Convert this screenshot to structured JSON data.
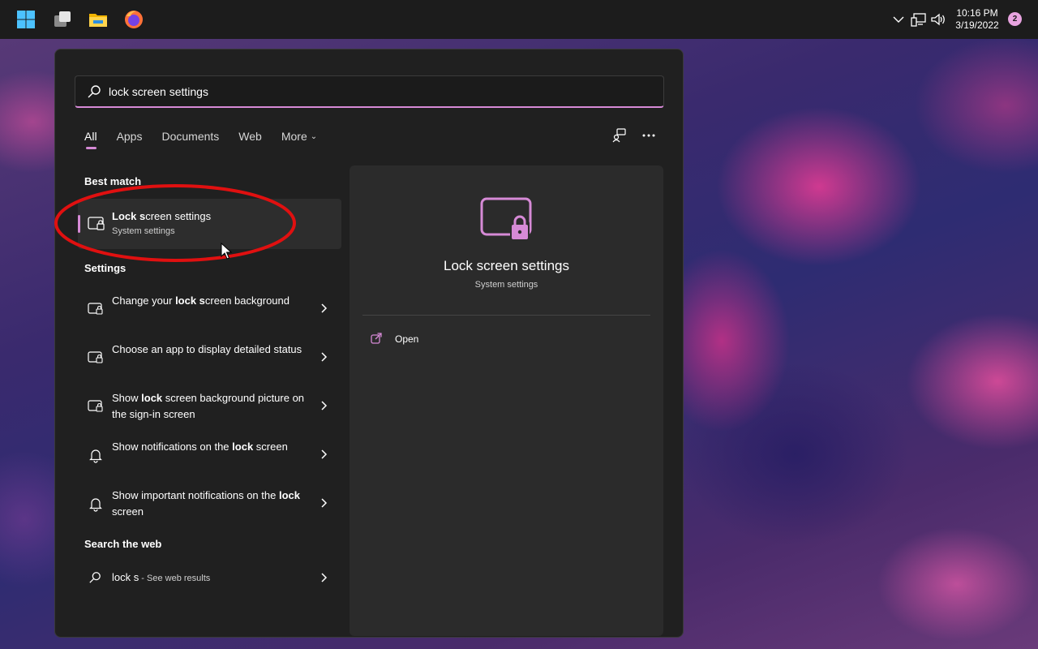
{
  "taskbar": {
    "icons": [
      "windows-start-icon",
      "task-view-icon",
      "file-explorer-icon",
      "firefox-icon"
    ],
    "tray_icons": [
      "chevron-up-icon",
      "network-icon",
      "volume-icon"
    ],
    "time": "10:16 PM",
    "date": "3/19/2022",
    "notification_count": "2"
  },
  "search": {
    "query": "lock screen settings"
  },
  "tabs": [
    {
      "label": "All"
    },
    {
      "label": "Apps"
    },
    {
      "label": "Documents"
    },
    {
      "label": "Web"
    },
    {
      "label": "More"
    }
  ],
  "sections": {
    "best_match": "Best match",
    "settings": "Settings",
    "search_web": "Search the web"
  },
  "best_match": {
    "title_bold": "Lock s",
    "title_rest": "creen settings",
    "subtitle": "System settings"
  },
  "settings_results": [
    {
      "parts": [
        "Change your ",
        "lock s",
        "creen background"
      ]
    },
    {
      "parts": [
        "Choose an app to display detailed status",
        "",
        ""
      ]
    },
    {
      "parts": [
        "Show ",
        "lock",
        " screen background picture on the sign-in screen"
      ]
    },
    {
      "parts": [
        "Show notifications on the ",
        "lock",
        " screen"
      ]
    },
    {
      "parts": [
        "Show important notifications on the ",
        "lock",
        " screen"
      ]
    }
  ],
  "web_result": {
    "query": "lock s",
    "suffix": " - See web results"
  },
  "preview": {
    "title": "Lock screen settings",
    "subtitle": "System settings",
    "open_label": "Open"
  },
  "colors": {
    "accent": "#d68ad6",
    "panel": "#202020",
    "preview": "#2b2b2b",
    "annotation": "#e01010"
  }
}
